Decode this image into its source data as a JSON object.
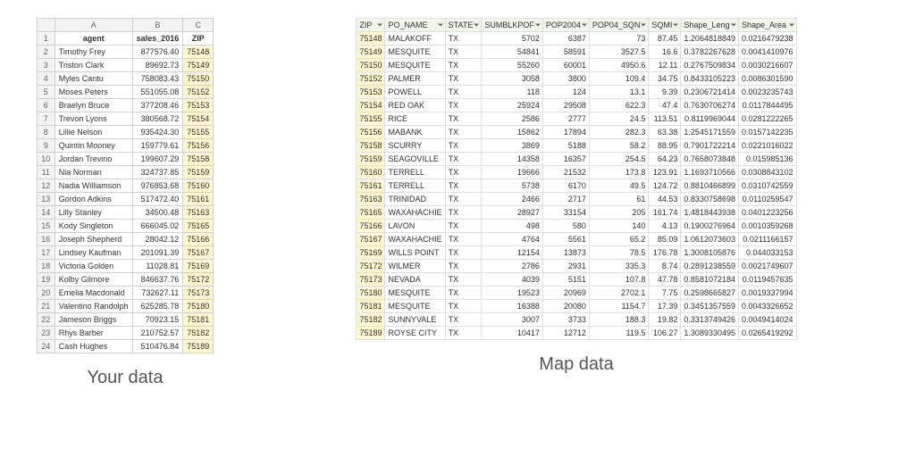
{
  "left": {
    "col_letters": [
      "A",
      "B",
      "C"
    ],
    "headers": [
      "agent",
      "sales_2016",
      "ZIP"
    ],
    "rows": [
      {
        "n": 2,
        "agent": "Timothy Frey",
        "sales": "877576.40",
        "zip": "75148"
      },
      {
        "n": 3,
        "agent": "Triston Clark",
        "sales": "89692.73",
        "zip": "75149"
      },
      {
        "n": 4,
        "agent": "Myles Cantu",
        "sales": "758083.43",
        "zip": "75150"
      },
      {
        "n": 5,
        "agent": "Moses Peters",
        "sales": "551055.08",
        "zip": "75152"
      },
      {
        "n": 6,
        "agent": "Braelyn Bruce",
        "sales": "377208.46",
        "zip": "75153"
      },
      {
        "n": 7,
        "agent": "Trevon Lyons",
        "sales": "380568.72",
        "zip": "75154"
      },
      {
        "n": 8,
        "agent": "Lillie Nelson",
        "sales": "935424.30",
        "zip": "75155"
      },
      {
        "n": 9,
        "agent": "Quintin Mooney",
        "sales": "159779.61",
        "zip": "75156"
      },
      {
        "n": 10,
        "agent": "Jordan Trevino",
        "sales": "199607.29",
        "zip": "75158"
      },
      {
        "n": 11,
        "agent": "Nia Norman",
        "sales": "324737.85",
        "zip": "75159"
      },
      {
        "n": 12,
        "agent": "Nadia Williamson",
        "sales": "976853.68",
        "zip": "75160"
      },
      {
        "n": 13,
        "agent": "Gordon Adkins",
        "sales": "517472.40",
        "zip": "75161"
      },
      {
        "n": 14,
        "agent": "Lilly Stanley",
        "sales": "34500.48",
        "zip": "75163"
      },
      {
        "n": 15,
        "agent": "Kody Singleton",
        "sales": "666045.02",
        "zip": "75165"
      },
      {
        "n": 16,
        "agent": "Joseph Shepherd",
        "sales": "28042.12",
        "zip": "75166"
      },
      {
        "n": 17,
        "agent": "Lindsey Kaufman",
        "sales": "201091.39",
        "zip": "75167"
      },
      {
        "n": 18,
        "agent": "Victoria Golden",
        "sales": "11028.81",
        "zip": "75169"
      },
      {
        "n": 19,
        "agent": "Kolby Gilmore",
        "sales": "846637.76",
        "zip": "75172"
      },
      {
        "n": 20,
        "agent": "Emelia Macdonald",
        "sales": "732627.11",
        "zip": "75173"
      },
      {
        "n": 21,
        "agent": "Valentino Randolph",
        "sales": "625285.78",
        "zip": "75180"
      },
      {
        "n": 22,
        "agent": "Jameson Briggs",
        "sales": "70923.15",
        "zip": "75181"
      },
      {
        "n": 23,
        "agent": "Rhys Barber",
        "sales": "210752.57",
        "zip": "75182"
      },
      {
        "n": 24,
        "agent": "Cash Hughes",
        "sales": "510476.84",
        "zip": "75189"
      }
    ],
    "caption": "Your data"
  },
  "right": {
    "headers": [
      "ZIP",
      "PO_NAME",
      "STATE",
      "SUMBLKPOF",
      "POP2004",
      "POP04_SQN",
      "SQMI",
      "Shape_Leng",
      "Shape_Area"
    ],
    "rows": [
      {
        "zip": "75148",
        "po": "MALAKOFF",
        "st": "TX",
        "c4": "5702",
        "c5": "6387",
        "c6": "73",
        "c7": "87.45",
        "c8": "1.2064818849",
        "c9": "0.0216479238"
      },
      {
        "zip": "75149",
        "po": "MESQUITE",
        "st": "TX",
        "c4": "54841",
        "c5": "58591",
        "c6": "3527.5",
        "c7": "16.6",
        "c8": "0.3782267628",
        "c9": "0.0041410976"
      },
      {
        "zip": "75150",
        "po": "MESQUITE",
        "st": "TX",
        "c4": "55260",
        "c5": "60001",
        "c6": "4950.6",
        "c7": "12.11",
        "c8": "0.2767509834",
        "c9": "0.0030216607"
      },
      {
        "zip": "75152",
        "po": "PALMER",
        "st": "TX",
        "c4": "3058",
        "c5": "3800",
        "c6": "109.4",
        "c7": "34.75",
        "c8": "0.8433105223",
        "c9": "0.0086301590"
      },
      {
        "zip": "75153",
        "po": "POWELL",
        "st": "TX",
        "c4": "118",
        "c5": "124",
        "c6": "13.1",
        "c7": "9.39",
        "c8": "0.2306721414",
        "c9": "0.0023235743"
      },
      {
        "zip": "75154",
        "po": "RED OAK",
        "st": "TX",
        "c4": "25924",
        "c5": "29508",
        "c6": "622.3",
        "c7": "47.4",
        "c8": "0.7630706274",
        "c9": "0.0117844495"
      },
      {
        "zip": "75155",
        "po": "RICE",
        "st": "TX",
        "c4": "2586",
        "c5": "2777",
        "c6": "24.5",
        "c7": "113.51",
        "c8": "0.8119969044",
        "c9": "0.0281222265"
      },
      {
        "zip": "75156",
        "po": "MABANK",
        "st": "TX",
        "c4": "15862",
        "c5": "17894",
        "c6": "282.3",
        "c7": "63.38",
        "c8": "1.2545171559",
        "c9": "0.0157142235"
      },
      {
        "zip": "75158",
        "po": "SCURRY",
        "st": "TX",
        "c4": "3869",
        "c5": "5188",
        "c6": "58.2",
        "c7": "88.95",
        "c8": "0.7901722214",
        "c9": "0.0221016022"
      },
      {
        "zip": "75159",
        "po": "SEAGOVILLE",
        "st": "TX",
        "c4": "14358",
        "c5": "16357",
        "c6": "254.5",
        "c7": "64.23",
        "c8": "0.7658073848",
        "c9": "0.015985136"
      },
      {
        "zip": "75160",
        "po": "TERRELL",
        "st": "TX",
        "c4": "19666",
        "c5": "21532",
        "c6": "173.8",
        "c7": "123.91",
        "c8": "1.1693710566",
        "c9": "0.0308843102"
      },
      {
        "zip": "75161",
        "po": "TERRELL",
        "st": "TX",
        "c4": "5738",
        "c5": "6170",
        "c6": "49.5",
        "c7": "124.72",
        "c8": "0.8810466899",
        "c9": "0.0310742559"
      },
      {
        "zip": "75163",
        "po": "TRINIDAD",
        "st": "TX",
        "c4": "2466",
        "c5": "2717",
        "c6": "61",
        "c7": "44.53",
        "c8": "0.8330758698",
        "c9": "0.0110259547"
      },
      {
        "zip": "75165",
        "po": "WAXAHACHIE",
        "st": "TX",
        "c4": "28927",
        "c5": "33154",
        "c6": "205",
        "c7": "161.74",
        "c8": "1.4818443938",
        "c9": "0.0401223256"
      },
      {
        "zip": "75166",
        "po": "LAVON",
        "st": "TX",
        "c4": "498",
        "c5": "580",
        "c6": "140",
        "c7": "4.13",
        "c8": "0.1900276964",
        "c9": "0.0010359268"
      },
      {
        "zip": "75167",
        "po": "WAXAHACHIE",
        "st": "TX",
        "c4": "4764",
        "c5": "5561",
        "c6": "65.2",
        "c7": "85.09",
        "c8": "1.0612073603",
        "c9": "0.0211166157"
      },
      {
        "zip": "75169",
        "po": "WILLS POINT",
        "st": "TX",
        "c4": "12154",
        "c5": "13873",
        "c6": "78.5",
        "c7": "176.78",
        "c8": "1.3008105876",
        "c9": "0.044033153"
      },
      {
        "zip": "75172",
        "po": "WILMER",
        "st": "TX",
        "c4": "2786",
        "c5": "2931",
        "c6": "335.3",
        "c7": "8.74",
        "c8": "0.2891238559",
        "c9": "0.0021749607"
      },
      {
        "zip": "75173",
        "po": "NEVADA",
        "st": "TX",
        "c4": "4039",
        "c5": "5151",
        "c6": "107.8",
        "c7": "47.78",
        "c8": "0.8581072184",
        "c9": "0.0119457635"
      },
      {
        "zip": "75180",
        "po": "MESQUITE",
        "st": "TX",
        "c4": "19523",
        "c5": "20969",
        "c6": "2702.1",
        "c7": "7.75",
        "c8": "0.2598665827",
        "c9": "0.0019337994"
      },
      {
        "zip": "75181",
        "po": "MESQUITE",
        "st": "TX",
        "c4": "16388",
        "c5": "20080",
        "c6": "1154.7",
        "c7": "17.39",
        "c8": "0.3451357559",
        "c9": "0.0043326652"
      },
      {
        "zip": "75182",
        "po": "SUNNYVALE",
        "st": "TX",
        "c4": "3007",
        "c5": "3733",
        "c6": "188.3",
        "c7": "19.82",
        "c8": "0.3313749426",
        "c9": "0.0049414024"
      },
      {
        "zip": "75189",
        "po": "ROYSE CITY",
        "st": "TX",
        "c4": "10417",
        "c5": "12712",
        "c6": "119.5",
        "c7": "106.27",
        "c8": "1.3089330495",
        "c9": "0.0265419292"
      }
    ],
    "caption": "Map data"
  }
}
